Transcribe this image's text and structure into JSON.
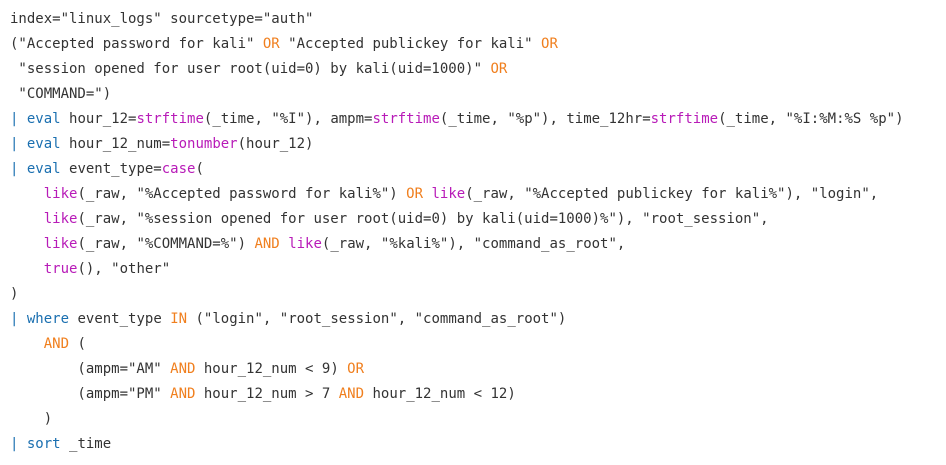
{
  "colors": {
    "text": "#333333",
    "pipe": "#1a6fb0",
    "command": "#1a6fb0",
    "function": "#b81bb8",
    "operator": "#f07f1e",
    "background": "#ffffff"
  },
  "code": {
    "lines": [
      [
        {
          "t": "plain",
          "v": "index=\"linux_logs\" sourcetype=\"auth\""
        }
      ],
      [
        {
          "t": "plain",
          "v": "(\"Accepted password for kali\" "
        },
        {
          "t": "op",
          "v": "OR"
        },
        {
          "t": "plain",
          "v": " \"Accepted publickey for kali\" "
        },
        {
          "t": "op",
          "v": "OR"
        }
      ],
      [
        {
          "t": "plain",
          "v": " \"session opened for user root(uid=0) by kali(uid=1000)\" "
        },
        {
          "t": "op",
          "v": "OR"
        }
      ],
      [
        {
          "t": "plain",
          "v": " \"COMMAND=\")"
        }
      ],
      [
        {
          "t": "pipe",
          "v": "|"
        },
        {
          "t": "plain",
          "v": " "
        },
        {
          "t": "cmd",
          "v": "eval"
        },
        {
          "t": "plain",
          "v": " hour_12="
        },
        {
          "t": "func",
          "v": "strftime"
        },
        {
          "t": "plain",
          "v": "(_time, \"%I\"), ampm="
        },
        {
          "t": "func",
          "v": "strftime"
        },
        {
          "t": "plain",
          "v": "(_time, \"%p\"), time_12hr="
        },
        {
          "t": "func",
          "v": "strftime"
        },
        {
          "t": "plain",
          "v": "(_time, \"%I:%M:%S %p\")"
        }
      ],
      [
        {
          "t": "pipe",
          "v": "|"
        },
        {
          "t": "plain",
          "v": " "
        },
        {
          "t": "cmd",
          "v": "eval"
        },
        {
          "t": "plain",
          "v": " hour_12_num="
        },
        {
          "t": "func",
          "v": "tonumber"
        },
        {
          "t": "plain",
          "v": "(hour_12)"
        }
      ],
      [
        {
          "t": "pipe",
          "v": "|"
        },
        {
          "t": "plain",
          "v": " "
        },
        {
          "t": "cmd",
          "v": "eval"
        },
        {
          "t": "plain",
          "v": " event_type="
        },
        {
          "t": "func",
          "v": "case"
        },
        {
          "t": "plain",
          "v": "("
        }
      ],
      [
        {
          "t": "plain",
          "v": "    "
        },
        {
          "t": "func",
          "v": "like"
        },
        {
          "t": "plain",
          "v": "(_raw, \"%Accepted password for kali%\") "
        },
        {
          "t": "op",
          "v": "OR"
        },
        {
          "t": "plain",
          "v": " "
        },
        {
          "t": "func",
          "v": "like"
        },
        {
          "t": "plain",
          "v": "(_raw, \"%Accepted publickey for kali%\"), \"login\","
        }
      ],
      [
        {
          "t": "plain",
          "v": "    "
        },
        {
          "t": "func",
          "v": "like"
        },
        {
          "t": "plain",
          "v": "(_raw, \"%session opened for user root(uid=0) by kali(uid=1000)%\"), \"root_session\","
        }
      ],
      [
        {
          "t": "plain",
          "v": "    "
        },
        {
          "t": "func",
          "v": "like"
        },
        {
          "t": "plain",
          "v": "(_raw, \"%COMMAND=%\") "
        },
        {
          "t": "op",
          "v": "AND"
        },
        {
          "t": "plain",
          "v": " "
        },
        {
          "t": "func",
          "v": "like"
        },
        {
          "t": "plain",
          "v": "(_raw, \"%kali%\"), \"command_as_root\","
        }
      ],
      [
        {
          "t": "plain",
          "v": "    "
        },
        {
          "t": "func",
          "v": "true"
        },
        {
          "t": "plain",
          "v": "(), \"other\""
        }
      ],
      [
        {
          "t": "plain",
          "v": ")"
        }
      ],
      [
        {
          "t": "pipe",
          "v": "|"
        },
        {
          "t": "plain",
          "v": " "
        },
        {
          "t": "cmd",
          "v": "where"
        },
        {
          "t": "plain",
          "v": " event_type "
        },
        {
          "t": "op",
          "v": "IN"
        },
        {
          "t": "plain",
          "v": " (\"login\", \"root_session\", \"command_as_root\")"
        }
      ],
      [
        {
          "t": "plain",
          "v": "    "
        },
        {
          "t": "op",
          "v": "AND"
        },
        {
          "t": "plain",
          "v": " ("
        }
      ],
      [
        {
          "t": "plain",
          "v": "        (ampm=\"AM\" "
        },
        {
          "t": "op",
          "v": "AND"
        },
        {
          "t": "plain",
          "v": " hour_12_num < 9) "
        },
        {
          "t": "op",
          "v": "OR"
        }
      ],
      [
        {
          "t": "plain",
          "v": "        (ampm=\"PM\" "
        },
        {
          "t": "op",
          "v": "AND"
        },
        {
          "t": "plain",
          "v": " hour_12_num > 7 "
        },
        {
          "t": "op",
          "v": "AND"
        },
        {
          "t": "plain",
          "v": " hour_12_num < 12)"
        }
      ],
      [
        {
          "t": "plain",
          "v": "    )"
        }
      ],
      [
        {
          "t": "pipe",
          "v": "|"
        },
        {
          "t": "plain",
          "v": " "
        },
        {
          "t": "cmd",
          "v": "sort"
        },
        {
          "t": "plain",
          "v": " _time"
        }
      ]
    ]
  }
}
